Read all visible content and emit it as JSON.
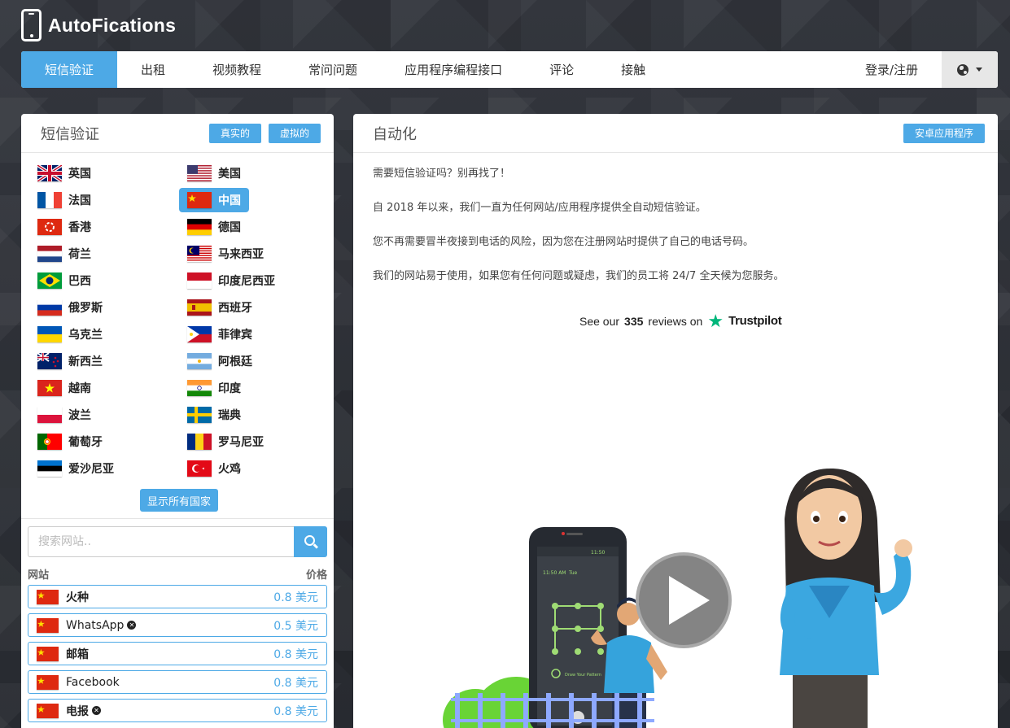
{
  "brand": {
    "name": "AutoFications"
  },
  "nav": {
    "items": [
      {
        "label": "短信验证",
        "active": true
      },
      {
        "label": "出租"
      },
      {
        "label": "视频教程"
      },
      {
        "label": "常问问题"
      },
      {
        "label": "应用程序编程接口"
      },
      {
        "label": "评论"
      },
      {
        "label": "接触"
      }
    ],
    "login_label": "登录/注册",
    "language_icon": "globe-icon"
  },
  "left_panel": {
    "title": "短信验证",
    "tab_real": "真实的",
    "tab_virtual": "虚拟的",
    "countries": [
      {
        "name": "英国",
        "flag": "uk"
      },
      {
        "name": "美国",
        "flag": "us"
      },
      {
        "name": "法国",
        "flag": "fr"
      },
      {
        "name": "中国",
        "flag": "cn",
        "selected": true
      },
      {
        "name": "香港",
        "flag": "hk"
      },
      {
        "name": "德国",
        "flag": "de"
      },
      {
        "name": "荷兰",
        "flag": "nl"
      },
      {
        "name": "马来西亚",
        "flag": "my"
      },
      {
        "name": "巴西",
        "flag": "br"
      },
      {
        "name": "印度尼西亚",
        "flag": "id"
      },
      {
        "name": "俄罗斯",
        "flag": "ru"
      },
      {
        "name": "西班牙",
        "flag": "es"
      },
      {
        "name": "乌克兰",
        "flag": "ua"
      },
      {
        "name": "菲律宾",
        "flag": "ph"
      },
      {
        "name": "新西兰",
        "flag": "nz"
      },
      {
        "name": "阿根廷",
        "flag": "ar"
      },
      {
        "name": "越南",
        "flag": "vn"
      },
      {
        "name": "印度",
        "flag": "in"
      },
      {
        "name": "波兰",
        "flag": "pl"
      },
      {
        "name": "瑞典",
        "flag": "se"
      },
      {
        "name": "葡萄牙",
        "flag": "pt"
      },
      {
        "name": "罗马尼亚",
        "flag": "ro"
      },
      {
        "name": "爱沙尼亚",
        "flag": "ee"
      },
      {
        "name": "火鸡",
        "flag": "tr"
      }
    ],
    "show_all_label": "显示所有国家",
    "search_placeholder": "搜索网站..",
    "col_site": "网站",
    "col_price": "价格",
    "services": [
      {
        "name": "火种",
        "price": "0.8 美元",
        "bold": true
      },
      {
        "name": "WhatsApp",
        "price": "0.5 美元",
        "badge": "x"
      },
      {
        "name": "邮箱",
        "price": "0.8 美元",
        "bold": true
      },
      {
        "name": "Facebook",
        "price": "0.8 美元"
      },
      {
        "name": "电报",
        "price": "0.8 美元",
        "bold": true,
        "badge": "x"
      }
    ]
  },
  "right_panel": {
    "title": "自动化",
    "android_button": "安卓应用程序",
    "paragraphs": [
      "需要短信验证吗？别再找了！",
      "自 2018 年以来，我们一直为任何网站/应用程序提供全自动短信验证。",
      "您不再需要冒半夜接到电话的风险，因为您在注册网站时提供了自己的电话号码。",
      "我们的网站易于使用，如果您有任何问题或疑虑，我们的员工将 24/7 全天候为您服务。"
    ],
    "trustpilot": {
      "prefix": "See our",
      "count": "335",
      "suffix": "reviews on",
      "brand": "Trustpilot"
    },
    "phone_screen": {
      "time": "11:50 AM",
      "day": "Tue",
      "status": "11:50",
      "caption": "Draw Your Pattern"
    }
  },
  "colors": {
    "accent": "#4da9e6",
    "trustpilot": "#00b67a"
  }
}
